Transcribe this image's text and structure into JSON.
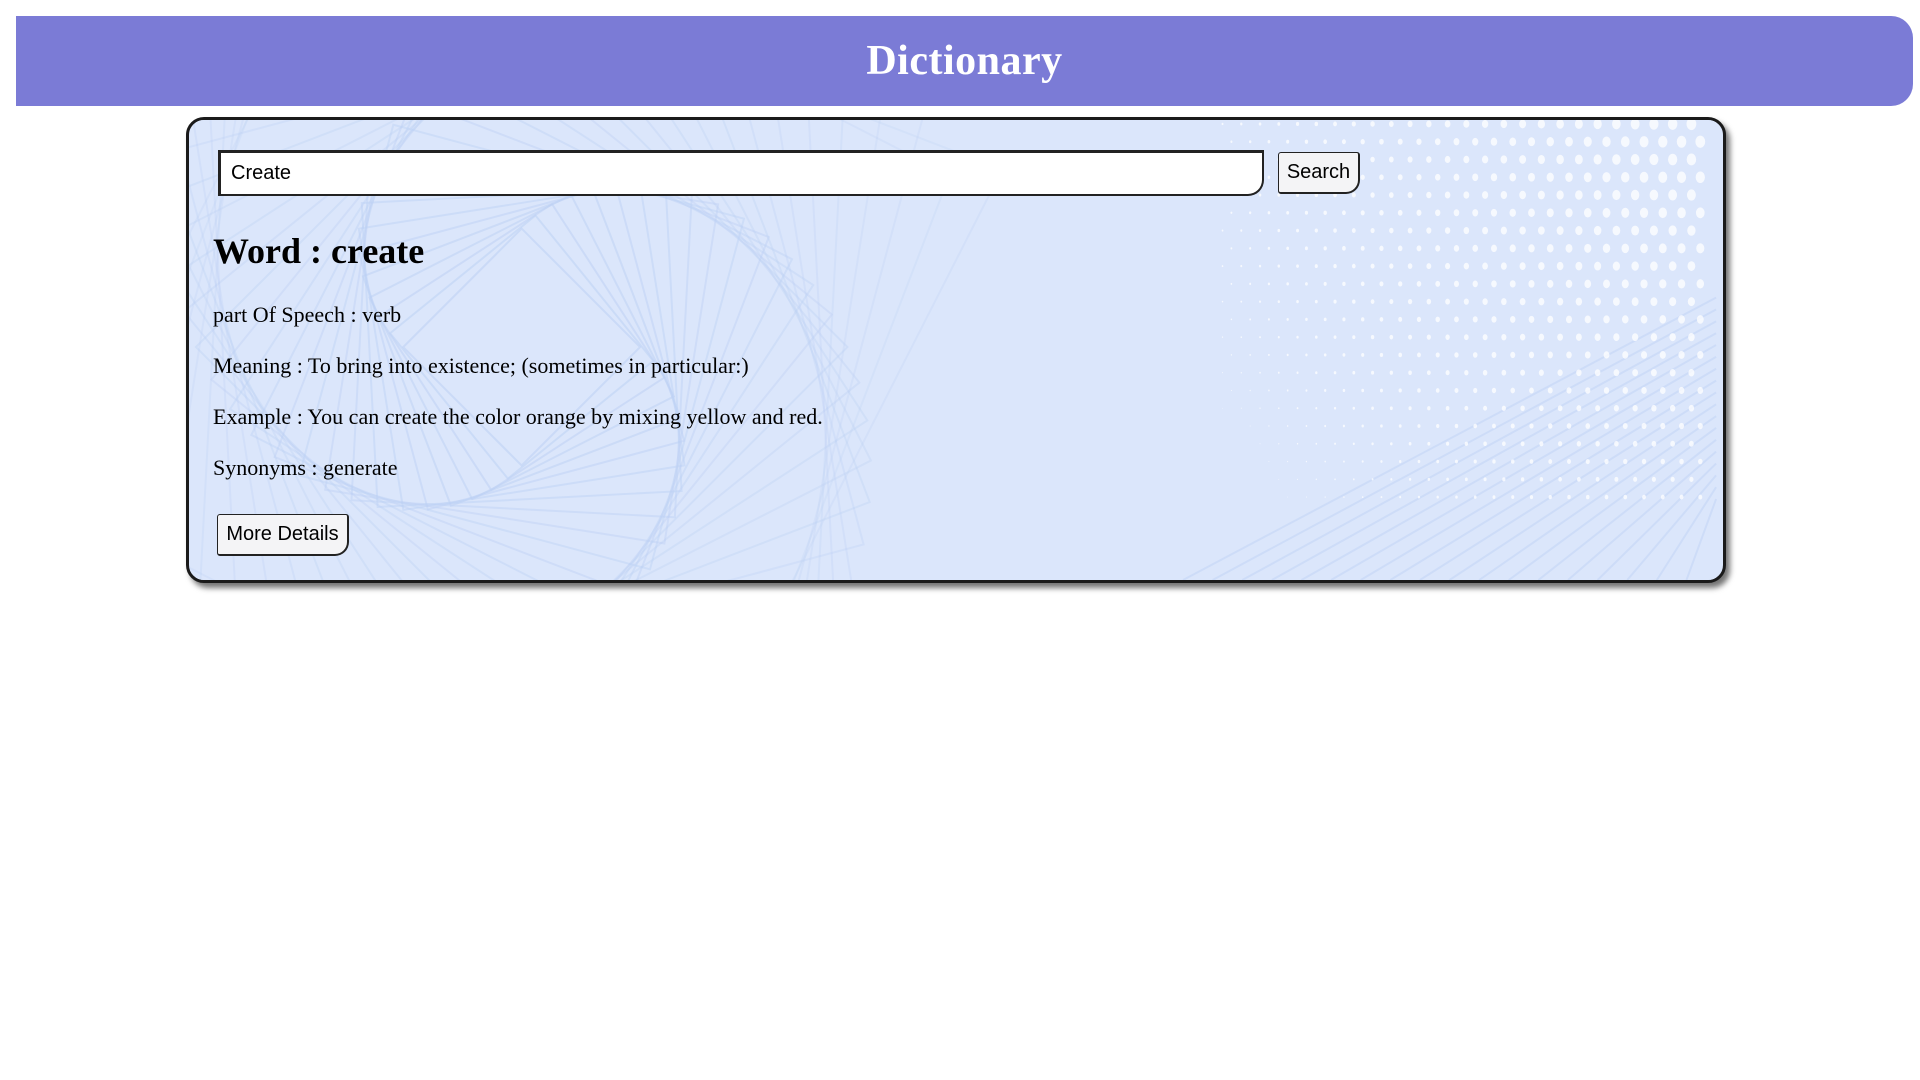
{
  "header": {
    "title": "Dictionary"
  },
  "search": {
    "value": "Create",
    "button_label": "Search"
  },
  "result": {
    "word_label": "Word",
    "word": "create",
    "part_of_speech_label": "part Of Speech",
    "part_of_speech": "verb",
    "meaning_label": "Meaning",
    "meaning": "To bring into existence; (sometimes in particular:)",
    "example_label": "Example",
    "example": "You can create the color orange by mixing yellow and red.",
    "synonyms_label": "Synonyms",
    "synonyms": "generate"
  },
  "actions": {
    "more_details_label": "More Details"
  },
  "colors": {
    "header_bg": "#7b7bd6",
    "header_text": "#ffffff",
    "card_bg": "#dbe6fb",
    "card_pattern": "#b9cdf3"
  }
}
